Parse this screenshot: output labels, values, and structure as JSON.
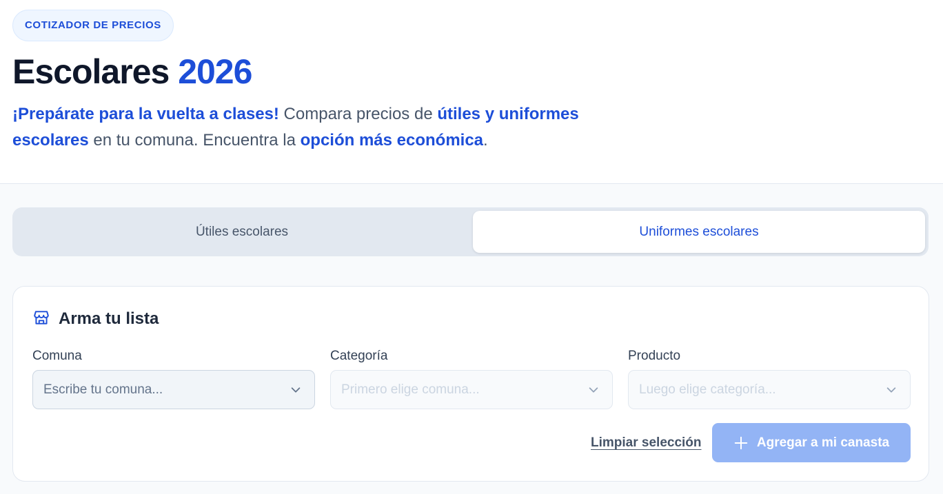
{
  "header": {
    "badge": "COTIZADOR DE PRECIOS",
    "title_main": "Escolares",
    "title_year": "2026",
    "lead": {
      "part1": "¡Prepárate para la vuelta a clases!",
      "part2": " Compara precios de ",
      "part3": "útiles y uniformes escolares",
      "part4": " en tu comuna. Encuentra la ",
      "part5": "opción más económica",
      "part6": "."
    }
  },
  "tabs": [
    {
      "label": "Útiles escolares",
      "selected": false
    },
    {
      "label": "Uniformes escolares",
      "selected": true
    }
  ],
  "builder": {
    "title": "Arma tu lista",
    "icon": "store-icon",
    "fields": [
      {
        "label": "Comuna",
        "placeholder": "Escribe tu comuna...",
        "enabled": true
      },
      {
        "label": "Categoría",
        "placeholder": "Primero elige comuna...",
        "enabled": false
      },
      {
        "label": "Producto",
        "placeholder": "Luego elige categoría...",
        "enabled": false
      }
    ],
    "clear_label": "Limpiar selección",
    "add_label": "Agregar a mi canasta",
    "add_icon": "plus-icon"
  },
  "colors": {
    "accent": "#1d4ed8",
    "accent_disabled": "#93b4f5",
    "text_dark": "#0f172a",
    "text_muted": "#475569"
  }
}
